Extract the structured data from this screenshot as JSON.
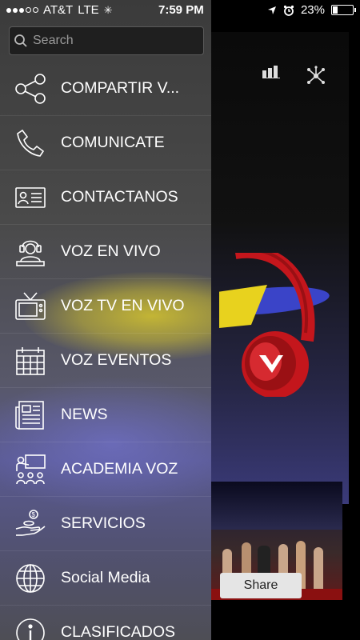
{
  "status_bar": {
    "carrier": "AT&T",
    "network": "LTE",
    "time": "7:59 PM",
    "battery": "23%",
    "battery_level": 0.23
  },
  "search": {
    "placeholder": "Search"
  },
  "menu": {
    "items": [
      {
        "label": "COMPARTIR V...",
        "icon": "share-icon"
      },
      {
        "label": "COMUNICATE",
        "icon": "phone-icon"
      },
      {
        "label": "CONTACTANOS",
        "icon": "contact-card-icon"
      },
      {
        "label": "VOZ EN VIVO",
        "icon": "radio-host-icon"
      },
      {
        "label": "VOZ TV EN VIVO",
        "icon": "tv-icon"
      },
      {
        "label": "VOZ EVENTOS",
        "icon": "calendar-icon"
      },
      {
        "label": "NEWS",
        "icon": "newspaper-icon"
      },
      {
        "label": "ACADEMIA VOZ",
        "icon": "classroom-icon"
      },
      {
        "label": "SERVICIOS",
        "icon": "hand-coins-icon"
      },
      {
        "label": "Social Media",
        "icon": "globe-icon"
      },
      {
        "label": "CLASIFICADOS",
        "icon": "info-icon"
      }
    ]
  },
  "background_app": {
    "share_label": "Share"
  }
}
